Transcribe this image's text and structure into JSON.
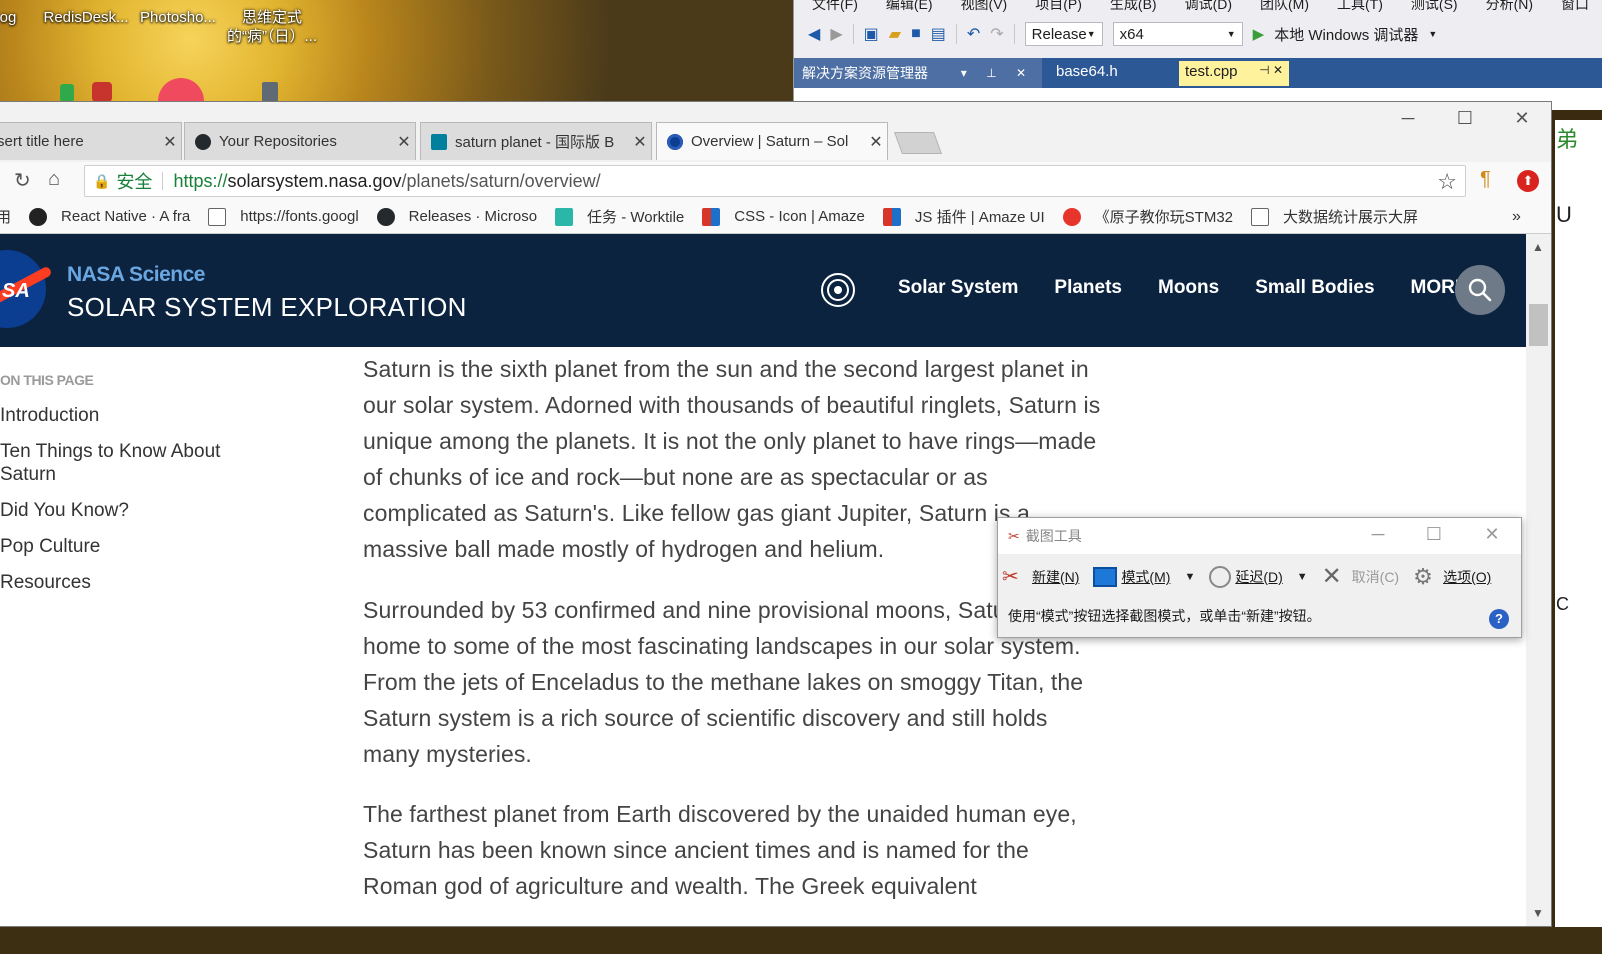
{
  "desktop": {
    "icons": [
      {
        "label": "og"
      },
      {
        "label": "RedisDesk..."
      },
      {
        "label": "Photosho..."
      },
      {
        "label": "思维定式的“病”（日）..."
      }
    ]
  },
  "vs": {
    "menu": [
      "文件(F)",
      "编辑(E)",
      "视图(V)",
      "项目(P)",
      "生成(B)",
      "调试(D)",
      "团队(M)",
      "工具(T)",
      "测试(S)",
      "分析(N)",
      "窗口"
    ],
    "config": "Release",
    "platform": "x64",
    "debugger": "本地 Windows 调试器",
    "panel_title": "解决方案资源管理器",
    "tabs": [
      "base64.h",
      "test.cpp"
    ],
    "right_glyphs": [
      "弟",
      "U",
      "C"
    ]
  },
  "chrome": {
    "tabs": [
      {
        "title": "sert title here",
        "active": false,
        "favicon": "none"
      },
      {
        "title": "Your Repositories",
        "active": false,
        "favicon": "github-icon"
      },
      {
        "title": "saturn planet - 国际版 B",
        "active": false,
        "favicon": "bing-icon"
      },
      {
        "title": "Overview | Saturn – Sol",
        "active": true,
        "favicon": "nasa-icon"
      }
    ],
    "secure_label": "安全",
    "url_scheme": "https://",
    "url_host": "solarsystem.nasa.gov",
    "url_path": "/planets/saturn/overview/",
    "bookmarks": [
      {
        "label": "用",
        "icon": "folder-icon"
      },
      {
        "label": "React Native · A fra",
        "icon": "react-icon"
      },
      {
        "label": "https://fonts.googl",
        "icon": "page-icon"
      },
      {
        "label": "Releases · Microso",
        "icon": "github-icon"
      },
      {
        "label": "任务 - Worktile",
        "icon": "worktile-icon"
      },
      {
        "label": "CSS - Icon | Amaze",
        "icon": "amaze-icon"
      },
      {
        "label": "JS 插件 | Amaze UI",
        "icon": "amaze-icon"
      },
      {
        "label": "《原子教你玩STM32",
        "icon": "stm-icon"
      },
      {
        "label": "大数据统计展示大屏",
        "icon": "page-icon"
      }
    ],
    "bookmarks_more": "»"
  },
  "nasa": {
    "logo_text": "SA",
    "science": "NASA Science",
    "site_title": "SOLAR SYSTEM EXPLORATION",
    "nav": [
      "Solar System",
      "Planets",
      "Moons",
      "Small Bodies",
      "MORE"
    ]
  },
  "toc": {
    "heading": "ON THIS PAGE",
    "items": [
      "Introduction",
      "Ten Things to Know About Saturn",
      "Did You Know?",
      "Pop Culture",
      "Resources"
    ]
  },
  "article": {
    "paragraphs": [
      "Saturn is the sixth planet from the sun and the second largest planet in our solar system. Adorned with thousands of beautiful ringlets, Saturn is unique among the planets. It is not the only planet to have rings—made of chunks of ice and rock—but none are as spectacular or as complicated as Saturn's. Like fellow gas giant Jupiter, Saturn is a massive ball made mostly of hydrogen and helium.",
      "Surrounded by 53 confirmed and nine provisional moons, Saturn is home to some of the most fascinating landscapes in our solar system. From the jets of Enceladus to the methane lakes on smoggy Titan, the Saturn system is a rich source of scientific discovery and still holds many mysteries.",
      "The farthest planet from Earth discovered by the unaided human eye, Saturn has been known since ancient times and is named for the Roman god of agriculture and wealth. The Greek equivalent"
    ]
  },
  "snip": {
    "title": "截图工具",
    "new": "新建(N)",
    "mode": "模式(M)",
    "delay": "延迟(D)",
    "cancel": "取消(C)",
    "options": "选项(O)",
    "hint": "使用“模式”按钮选择截图模式，或单击“新建”按钮。",
    "help": "?"
  },
  "colors": {
    "nasa_navy": "#0c2340",
    "nasa_science_blue": "#6aa7e0",
    "secure_green": "#188038",
    "vs_blue": "#2d5896"
  }
}
